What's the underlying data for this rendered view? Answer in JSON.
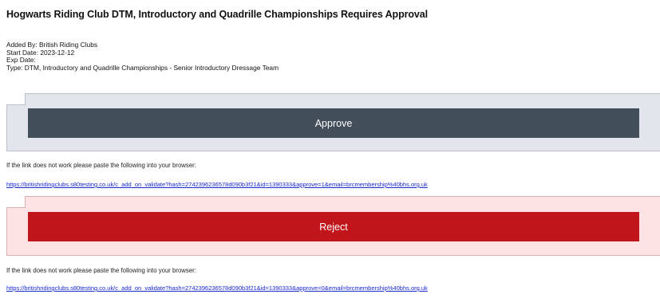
{
  "email": {
    "title": "Hogwarts Riding Club DTM, Introductory and Quadrille Championships Requires Approval",
    "meta": {
      "added_by": "Added By: British Riding Clubs",
      "start_date": "Start Date: 2023-12-12",
      "exp_date": "Exp Date:",
      "type": "Type: DTM, Introductory and Quadrille Championships - Senior Introductory Dressage Team"
    },
    "approve": {
      "button_label": "Approve",
      "note": "If the link does not work please paste the following into your browser:",
      "link": "https://britishridingclubs.s80testing.co.uk/c_add_on_validate?hash=2742396236578d090b3f21&id=1390333&approve=1&email=brcmembership%40bhs.org.uk"
    },
    "reject": {
      "button_label": "Reject",
      "note": "If the link does not work please paste the following into your browser:",
      "link": "https://britishridingclubs.s80testing.co.uk/c_add_on_validate?hash=2742396236578d090b3f21&id=1390333&approve=0&email=brcmembership%40bhs.org.uk"
    }
  },
  "colors": {
    "approve_button": "#434e5b",
    "approve_panel": "#e2e6ec",
    "reject_button": "#c0151a",
    "reject_panel": "#fde3e3",
    "link": "#1a2bd0"
  }
}
